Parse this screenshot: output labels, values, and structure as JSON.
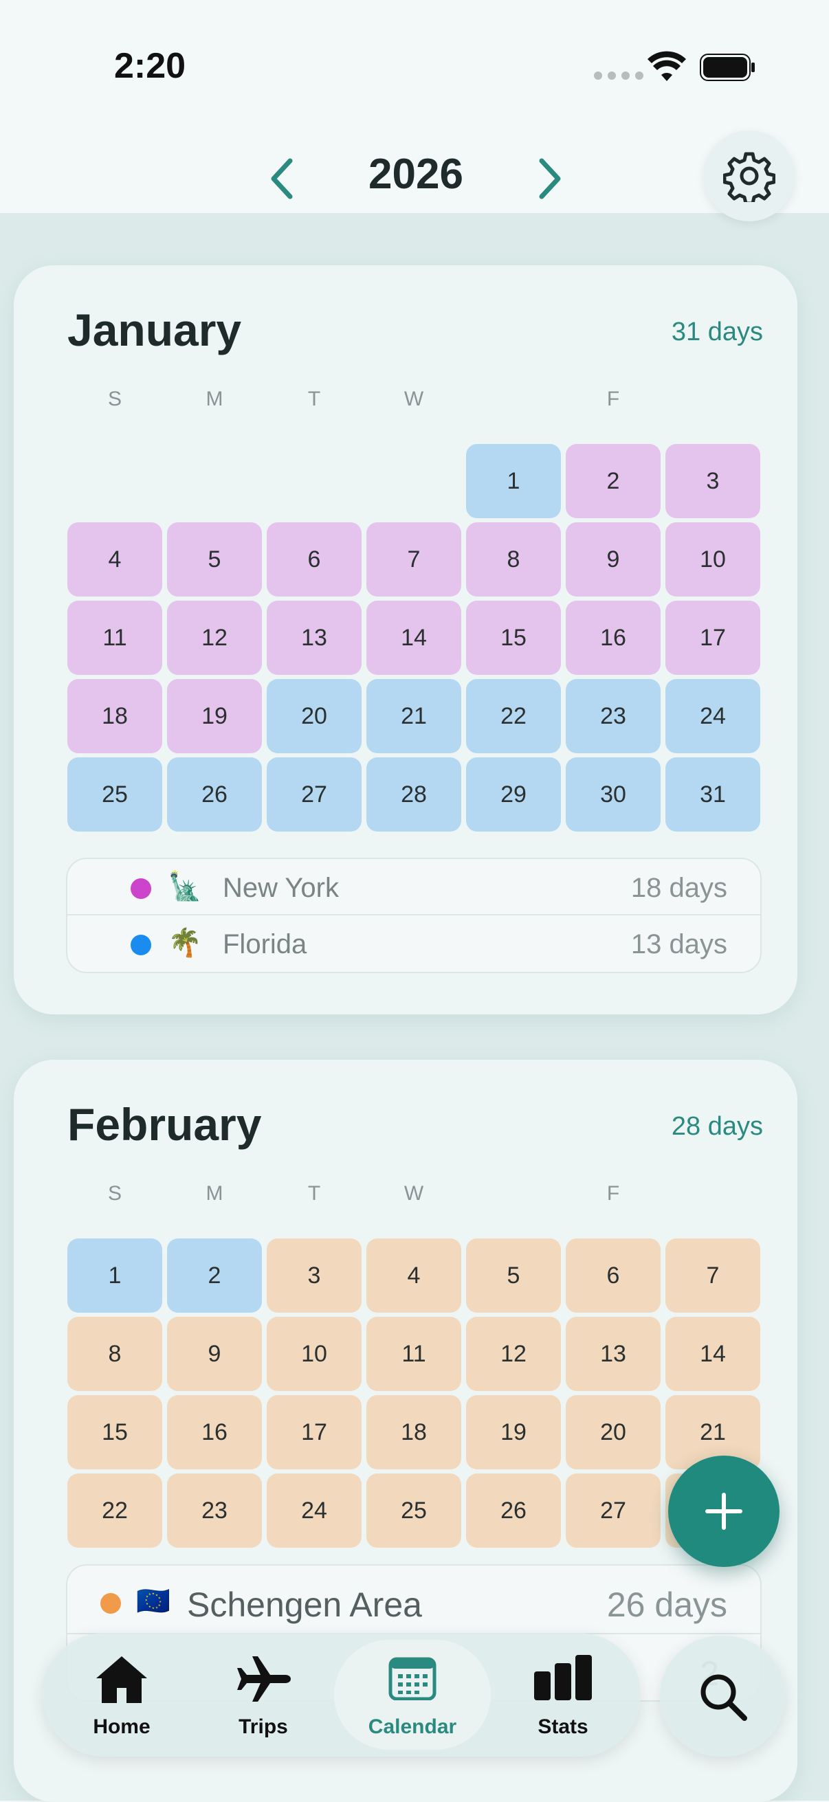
{
  "status_bar": {
    "time": "2:20"
  },
  "header": {
    "year": "2026"
  },
  "colors": {
    "new_york": "#cc44cc",
    "florida": "#1a8cf0",
    "schengen": "#f09a4a",
    "accent": "#1f8a7d"
  },
  "weekdays": [
    "S",
    "M",
    "T",
    "W",
    "",
    "F",
    ""
  ],
  "months": [
    {
      "name": "January",
      "days_label": "31 days",
      "days": [
        {
          "d": "1",
          "t": "fl"
        },
        {
          "d": "2",
          "t": "ny"
        },
        {
          "d": "3",
          "t": "ny"
        },
        {
          "d": "4",
          "t": "ny"
        },
        {
          "d": "5",
          "t": "ny"
        },
        {
          "d": "6",
          "t": "ny"
        },
        {
          "d": "7",
          "t": "ny"
        },
        {
          "d": "8",
          "t": "ny"
        },
        {
          "d": "9",
          "t": "ny"
        },
        {
          "d": "10",
          "t": "ny"
        },
        {
          "d": "11",
          "t": "ny"
        },
        {
          "d": "12",
          "t": "ny"
        },
        {
          "d": "13",
          "t": "ny"
        },
        {
          "d": "14",
          "t": "ny"
        },
        {
          "d": "15",
          "t": "ny"
        },
        {
          "d": "16",
          "t": "ny"
        },
        {
          "d": "17",
          "t": "ny"
        },
        {
          "d": "18",
          "t": "ny"
        },
        {
          "d": "19",
          "t": "ny"
        },
        {
          "d": "20",
          "t": "fl"
        },
        {
          "d": "21",
          "t": "fl"
        },
        {
          "d": "22",
          "t": "fl"
        },
        {
          "d": "23",
          "t": "fl"
        },
        {
          "d": "24",
          "t": "fl"
        },
        {
          "d": "25",
          "t": "fl"
        },
        {
          "d": "26",
          "t": "fl"
        },
        {
          "d": "27",
          "t": "fl"
        },
        {
          "d": "28",
          "t": "fl"
        },
        {
          "d": "29",
          "t": "fl"
        },
        {
          "d": "30",
          "t": "fl"
        },
        {
          "d": "31",
          "t": "fl"
        }
      ],
      "legend": [
        {
          "name": "New York",
          "count": "18 days",
          "emoji": "🗽"
        },
        {
          "name": "Florida",
          "count": "13 days",
          "emoji": "🌴"
        }
      ]
    },
    {
      "name": "February",
      "days_label": "28 days",
      "days": [
        {
          "d": "1",
          "t": "fl"
        },
        {
          "d": "2",
          "t": "fl"
        },
        {
          "d": "3",
          "t": "sc"
        },
        {
          "d": "4",
          "t": "sc"
        },
        {
          "d": "5",
          "t": "sc"
        },
        {
          "d": "6",
          "t": "sc"
        },
        {
          "d": "7",
          "t": "sc"
        },
        {
          "d": "8",
          "t": "sc"
        },
        {
          "d": "9",
          "t": "sc"
        },
        {
          "d": "10",
          "t": "sc"
        },
        {
          "d": "11",
          "t": "sc"
        },
        {
          "d": "12",
          "t": "sc"
        },
        {
          "d": "13",
          "t": "sc"
        },
        {
          "d": "14",
          "t": "sc"
        },
        {
          "d": "15",
          "t": "sc"
        },
        {
          "d": "16",
          "t": "sc"
        },
        {
          "d": "17",
          "t": "sc"
        },
        {
          "d": "18",
          "t": "sc"
        },
        {
          "d": "19",
          "t": "sc"
        },
        {
          "d": "20",
          "t": "sc"
        },
        {
          "d": "21",
          "t": "sc"
        },
        {
          "d": "22",
          "t": "sc"
        },
        {
          "d": "23",
          "t": "sc"
        },
        {
          "d": "24",
          "t": "sc"
        },
        {
          "d": "25",
          "t": "sc"
        },
        {
          "d": "26",
          "t": "sc"
        },
        {
          "d": "27",
          "t": "sc"
        },
        {
          "d": "28",
          "t": "sc"
        }
      ],
      "legend": [
        {
          "name": "Schengen Area",
          "count": "26 days",
          "emoji": "🇪🇺"
        },
        {
          "name": "",
          "count": "2",
          "emoji": ""
        }
      ]
    }
  ],
  "tabs": [
    {
      "label": "Home",
      "icon": "home-icon"
    },
    {
      "label": "Trips",
      "icon": "airplane-icon"
    },
    {
      "label": "Calendar",
      "icon": "calendar-icon"
    },
    {
      "label": "Stats",
      "icon": "stats-icon"
    }
  ]
}
